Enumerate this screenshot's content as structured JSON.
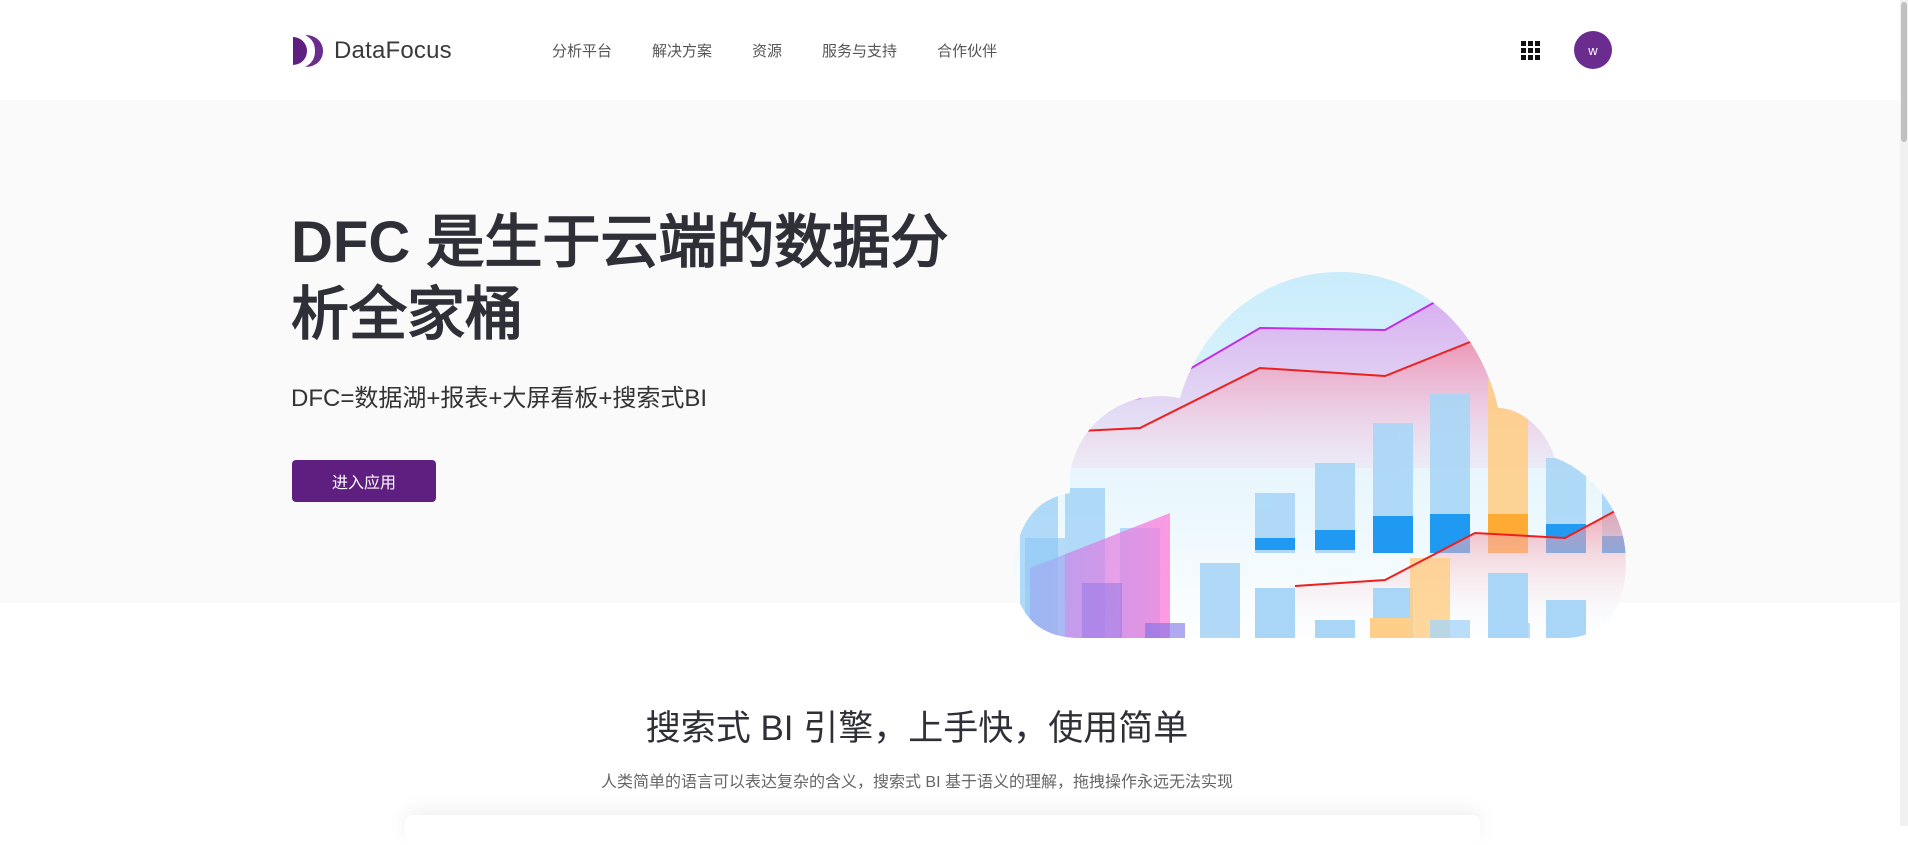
{
  "brand": {
    "name": "DataFocus",
    "color": "#5f1f80"
  },
  "nav": {
    "items": [
      "分析平台",
      "解决方案",
      "资源",
      "服务与支持",
      "合作伙伴"
    ]
  },
  "user": {
    "initial": "w"
  },
  "hero": {
    "title": "DFC 是生于云端的数据分析全家桶",
    "subtitle": "DFC=数据湖+报表+大屏看板+搜索式BI",
    "cta_label": "进入应用"
  },
  "section": {
    "title": "搜索式 BI 引擎，上手快，使用简单",
    "subtitle": "人类简单的语言可以表达复杂的含义，搜索式 BI 基于语义的理解，拖拽操作永远无法实现"
  },
  "icons": {
    "apps": "grid-apps-icon",
    "logo": "datafocus-logo-icon"
  },
  "colors": {
    "accent": "#5f1f80",
    "bar_blue": "#0a8ff2",
    "bar_light": "#a9d6f7",
    "bar_orange": "#ffa31f",
    "line_red": "#ee1f1f",
    "line_purple": "#c42de0"
  }
}
